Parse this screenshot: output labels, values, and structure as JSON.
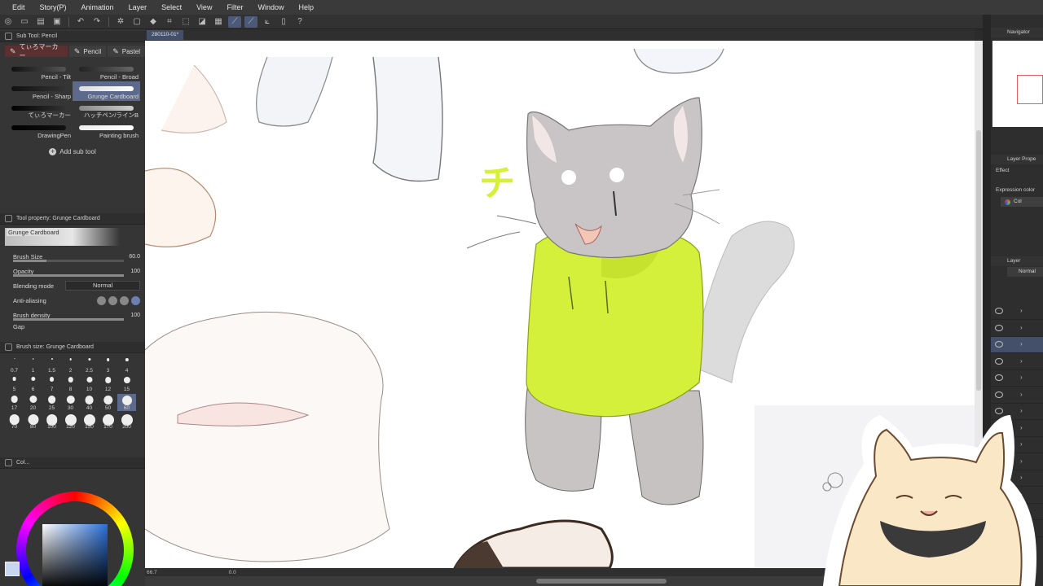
{
  "app": {
    "menu": [
      "Edit",
      "Story(P)",
      "Animation",
      "Layer",
      "Select",
      "View",
      "Filter",
      "Window",
      "Help"
    ]
  },
  "canvas": {
    "tab_title": "280110-01*",
    "zoom": "66.7",
    "rotation": "0.0"
  },
  "sub_tool": {
    "panel_title": "Sub Tool: Pencil",
    "tabs": [
      {
        "label": "てぃろマーカー",
        "active": true
      },
      {
        "label": "Pencil",
        "active": false
      },
      {
        "label": "Pastel",
        "active": false
      }
    ],
    "brushes": [
      {
        "label": "Pencil - Tilt",
        "selected": false
      },
      {
        "label": "Pencil - Broad",
        "selected": false
      },
      {
        "label": "Pencil - Sharp",
        "selected": false
      },
      {
        "label": "Grunge Cardboard",
        "selected": true
      },
      {
        "label": "てぃろマーカー",
        "selected": false
      },
      {
        "label": "ハッチペン/ラインB",
        "selected": false
      },
      {
        "label": "DrawingPen",
        "selected": false
      },
      {
        "label": "Painting brush",
        "selected": false
      }
    ],
    "add_label": "Add sub tool"
  },
  "tool_property": {
    "panel_title": "Tool property: Grunge Cardboard",
    "preview_name": "Grunge Cardboard",
    "brush_size": {
      "label": "Brush Size",
      "value": "60.0"
    },
    "opacity": {
      "label": "Opacity",
      "value": "100"
    },
    "blending": {
      "label": "Blending mode",
      "value": "Normal"
    },
    "anti_aliasing": {
      "label": "Anti-aliasing"
    },
    "brush_density": {
      "label": "Brush density",
      "value": "100"
    },
    "gap_label": "Gap"
  },
  "brush_size_panel": {
    "panel_title": "Brush size: Grunge Cardboard",
    "sizes": [
      "0.7",
      "1",
      "1.5",
      "2",
      "2.5",
      "3",
      "4",
      "5",
      "6",
      "7",
      "8",
      "10",
      "12",
      "15",
      "17",
      "20",
      "25",
      "30",
      "40",
      "50",
      "60",
      "70",
      "80",
      "100",
      "120",
      "150",
      "170",
      "200"
    ],
    "selected": "60"
  },
  "color_panel": {
    "title": "Col..."
  },
  "right": {
    "navigator": "Navigator",
    "layer_property": "Layer Prope",
    "effect": "Effect",
    "expression_color": "Expression color",
    "color_btn": "Col",
    "layer": "Layer",
    "blend_mode": "Normal"
  },
  "colors": {
    "accent": "#5d6a8c",
    "canvas_bg": "#ffffff",
    "hoodie": "#d4f03a"
  }
}
